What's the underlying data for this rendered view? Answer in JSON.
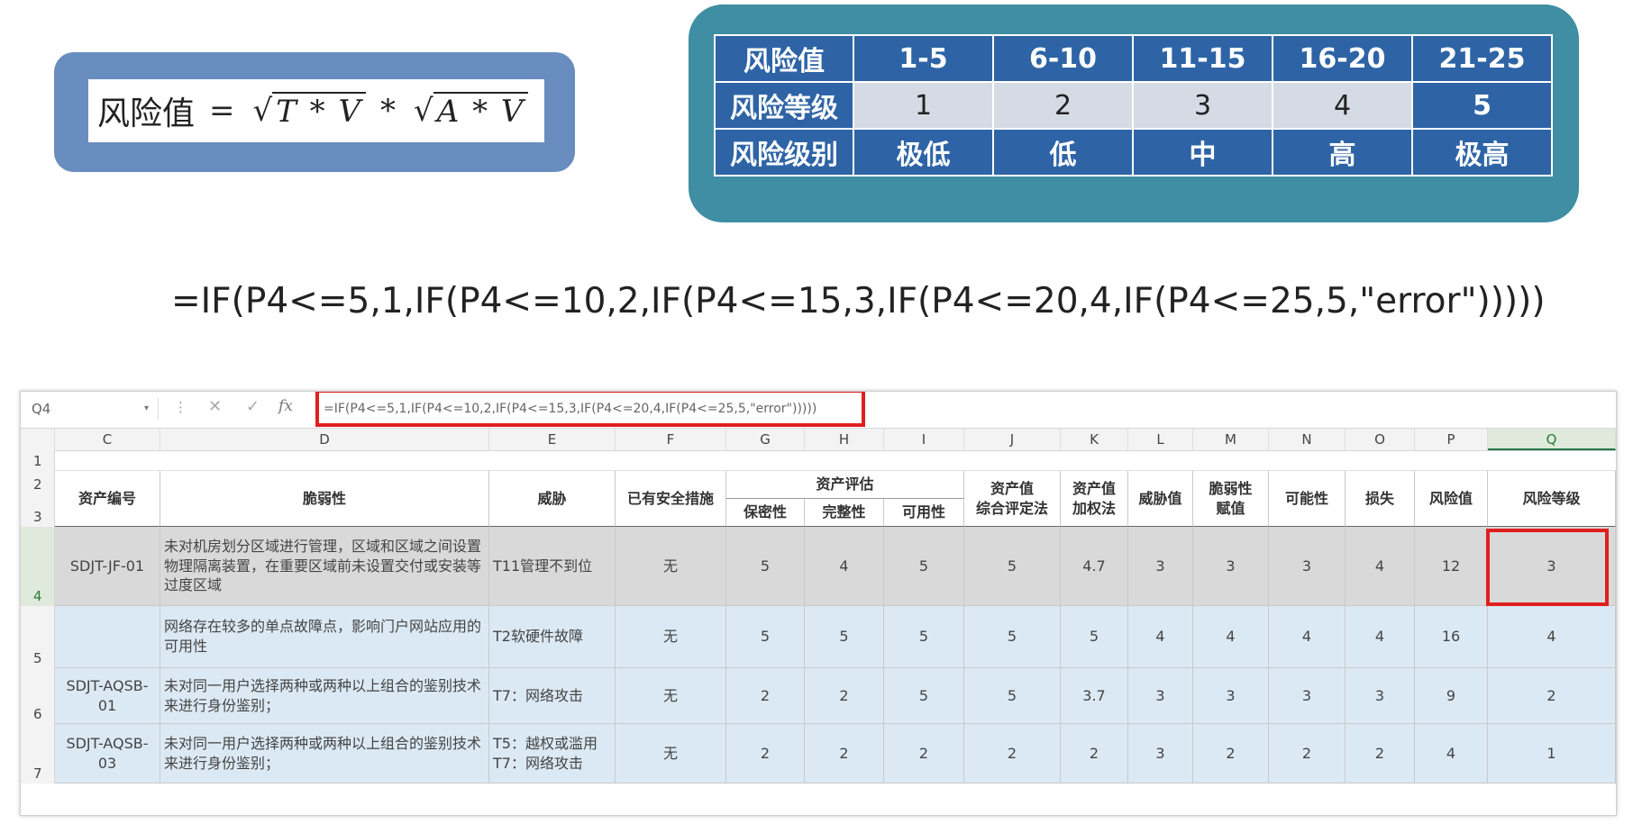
{
  "formula_card": {
    "lhs": "风险值",
    "equals": "=",
    "radicand1": "T * V",
    "times": "*",
    "radicand2": "A * V"
  },
  "risk_table": {
    "row_labels": [
      "风险值",
      "风险等级",
      "风险级别"
    ],
    "ranges": [
      "1-5",
      "6-10",
      "11-15",
      "16-20",
      "21-25"
    ],
    "grades": [
      "1",
      "2",
      "3",
      "4",
      "5"
    ],
    "levels": [
      "极低",
      "低",
      "中",
      "高",
      "极高"
    ],
    "highlight_grade": "5"
  },
  "big_formula": "=IF(P4<=5,1,IF(P4<=10,2,IF(P4<=15,3,IF(P4<=20,4,IF(P4<=25,5,\"error\")))))",
  "excel": {
    "namebox": "Q4",
    "formula": "=IF(P4<=5,1,IF(P4<=10,2,IF(P4<=15,3,IF(P4<=20,4,IF(P4<=25,5,\"error\")))))",
    "column_letters": [
      "C",
      "D",
      "E",
      "F",
      "G",
      "H",
      "I",
      "J",
      "K",
      "L",
      "M",
      "N",
      "O",
      "P",
      "Q"
    ],
    "row_numbers": [
      "1",
      "2",
      "3",
      "4",
      "5",
      "6",
      "7"
    ],
    "headers": {
      "asset_id": "资产编号",
      "vulnerability": "脆弱性",
      "threat": "威胁",
      "existing_measures": "已有安全措施",
      "asset_eval": "资产评估",
      "confidentiality": "保密性",
      "integrity": "完整性",
      "availability": "可用性",
      "asset_value_comprehensive": "资产值\n综合评定法",
      "asset_value_weighted": "资产值\n加权法",
      "threat_value": "威胁值",
      "vuln_value": "脆弱性\n赋值",
      "likelihood": "可能性",
      "loss": "损失",
      "risk_value": "风险值",
      "risk_grade": "风险等级"
    },
    "rows": [
      {
        "asset_id": "SDJT-JF-01",
        "vulnerability": "未对机房划分区域进行管理，区域和区域之间设置物理隔离装置，在重要区域前未设置交付或安装等过度区域",
        "threat": "T11管理不到位",
        "measures": "无",
        "c": "5",
        "i": "4",
        "a": "5",
        "comp": "5",
        "weighted": "4.7",
        "threat_v": "3",
        "vuln_v": "3",
        "likelihood": "3",
        "loss": "4",
        "risk": "12",
        "grade": "3"
      },
      {
        "asset_id": "",
        "vulnerability": "网络存在较多的单点故障点，影响门户网站应用的可用性",
        "threat": "T2软硬件故障",
        "measures": "无",
        "c": "5",
        "i": "5",
        "a": "5",
        "comp": "5",
        "weighted": "5",
        "threat_v": "4",
        "vuln_v": "4",
        "likelihood": "4",
        "loss": "4",
        "risk": "16",
        "grade": "4"
      },
      {
        "asset_id": "SDJT-AQSB-\n01",
        "vulnerability": "未对同一用户选择两种或两种以上组合的鉴别技术来进行身份鉴别；",
        "threat": "T7：网络攻击",
        "measures": "无",
        "c": "2",
        "i": "2",
        "a": "5",
        "comp": "5",
        "weighted": "3.7",
        "threat_v": "3",
        "vuln_v": "3",
        "likelihood": "3",
        "loss": "3",
        "risk": "9",
        "grade": "2"
      },
      {
        "asset_id": "SDJT-AQSB-\n03",
        "vulnerability": "未对同一用户选择两种或两种以上组合的鉴别技术来进行身份鉴别；",
        "threat": "T5：越权或滥用\nT7：网络攻击",
        "measures": "无",
        "c": "2",
        "i": "2",
        "a": "2",
        "comp": "2",
        "weighted": "2",
        "threat_v": "3",
        "vuln_v": "2",
        "likelihood": "2",
        "loss": "2",
        "risk": "4",
        "grade": "1"
      }
    ]
  }
}
